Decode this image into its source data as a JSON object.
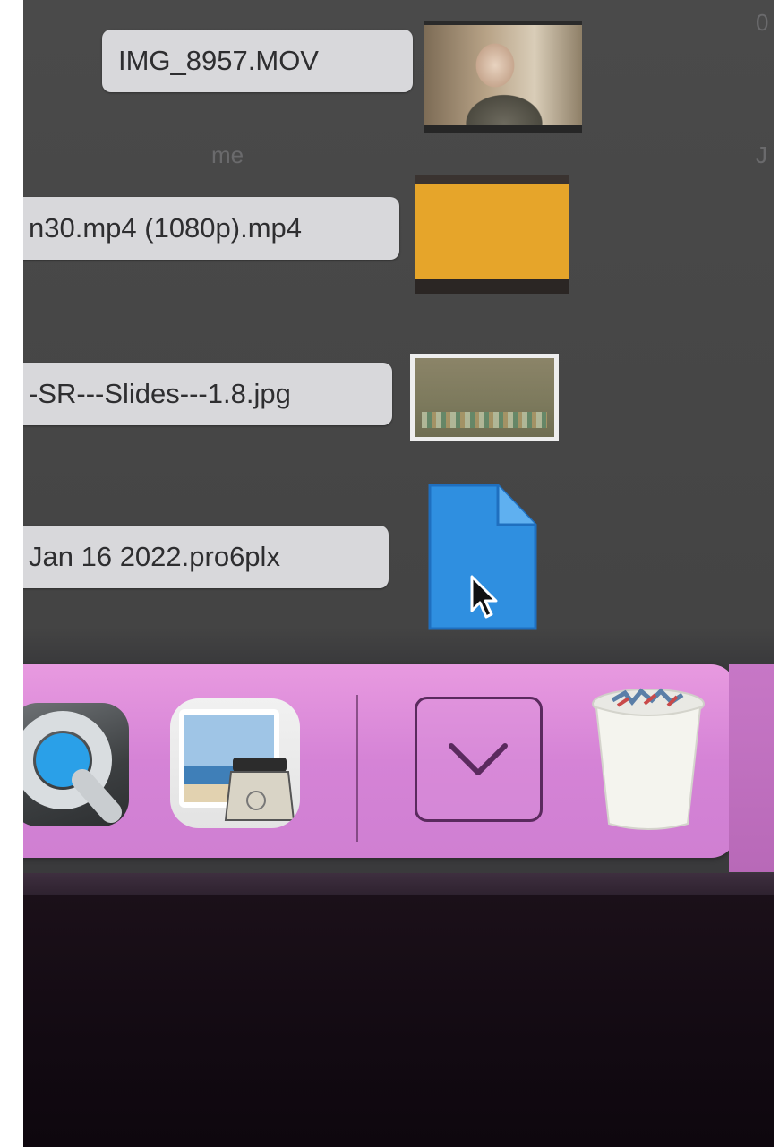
{
  "desktop": {
    "files": [
      {
        "label": "IMG_8957.MOV",
        "kind": "movie"
      },
      {
        "label": "n30.mp4 (1080p).mp4",
        "kind": "movie"
      },
      {
        "label": "-SR---Slides---1.8.jpg",
        "kind": "image"
      },
      {
        "label": "Jan 16 2022.pro6plx",
        "kind": "document"
      }
    ],
    "faint_texts": [
      "me",
      "0",
      "J"
    ]
  },
  "dock": {
    "apps": [
      {
        "name": "quicktime-player",
        "icon": "quicktime-icon"
      },
      {
        "name": "preview",
        "icon": "preview-icon"
      },
      {
        "name": "downloads",
        "icon": "chevron-down-icon"
      },
      {
        "name": "trash",
        "icon": "trash-icon"
      }
    ]
  },
  "colors": {
    "document_icon": "#2f8fe0",
    "dock_background": "#d98ad8",
    "label_background": "#d8d8db",
    "desktop_background": "#474747"
  }
}
